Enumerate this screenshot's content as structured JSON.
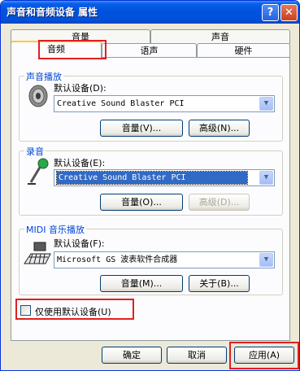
{
  "window": {
    "title": "声音和音频设备 属性",
    "help": "?",
    "close": "✕"
  },
  "tabs": {
    "row1": [
      "音量",
      "声音"
    ],
    "row2": [
      "音频",
      "语声",
      "硬件"
    ]
  },
  "playback": {
    "group": "声音播放",
    "device_label": "默认设备(D):",
    "device": "Creative Sound Blaster PCI",
    "volume_button": "音量(V)...",
    "advanced_button": "高级(N)...",
    "icon": "speaker-icon"
  },
  "recording": {
    "group": "录音",
    "device_label": "默认设备(E):",
    "device": "Creative Sound Blaster PCI",
    "volume_button": "音量(O)...",
    "advanced_button": "高级(D)...",
    "icon": "microphone-icon"
  },
  "midi": {
    "group": "MIDI 音乐播放",
    "device_label": "默认设备(F):",
    "device": "Microsoft GS 波表软件合成器",
    "volume_button": "音量(M)...",
    "about_button": "关于(B)...",
    "icon": "keyboard-icon"
  },
  "use_default_only": {
    "label": "仅使用默认设备(U)",
    "checked": false
  },
  "footer": {
    "ok": "确定",
    "cancel": "取消",
    "apply": "应用(A)"
  },
  "colors": {
    "highlight": "#E02020",
    "group_label": "#0046D5",
    "titlebar": "#0053E1"
  }
}
